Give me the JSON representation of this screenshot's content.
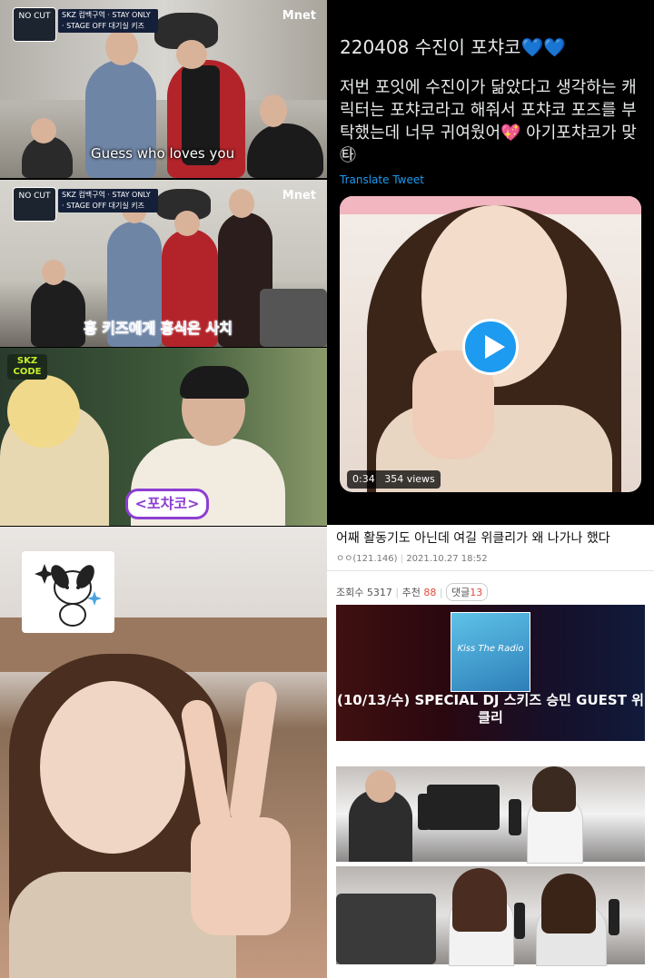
{
  "panel1": {
    "show_logo": "NO CUT",
    "strip_text": "SKZ 컴백구역 · STAY ONLY · STAGE OFF 대기실 키즈",
    "broadcaster": "Mnet",
    "caption": "Guess who loves you"
  },
  "panel2": {
    "show_logo": "NO CUT",
    "strip_text": "SKZ 컴백구역 · STAY ONLY · STAGE OFF 대기실 키즈",
    "broadcaster": "Mnet",
    "caption": "흥 키즈에게 흥식은 사치"
  },
  "panel3": {
    "show_logo": "SKZ CODE",
    "caption": "<포챠코>"
  },
  "tweet": {
    "title": "220408 수진이 포챠코💙💙",
    "body": "저번 포잇에 수진이가 닮았다고 생각하는 캐릭터는 포챠코라고 해줘서 포챠코 포즈를 부탁했는데 너무 귀여웠어💖 아기포챠코가 맞㉹",
    "translate_label": "Translate Tweet",
    "video_duration": "0:34",
    "video_views": "354 views"
  },
  "post": {
    "title": "어째 활동기도 아닌데 여길 위클리가 왜 나가나 했다",
    "author": "ㅇㅇ(121.146)",
    "date": "2021.10.27 18:52",
    "views_label": "조회수",
    "views": "5317",
    "recommend_label": "추천",
    "recommend": "88",
    "comments_label": "댓글",
    "comments": "13",
    "banner_caption": "(10/13/수) SPECIAL DJ 스키즈 승민 GUEST 위클리",
    "album_text": "Kiss The Radio"
  },
  "colors": {
    "twitter_blue": "#1d9bf0",
    "pochako_purple": "#8c3fd2",
    "caption_blue": "#2a67c9",
    "recommend_red": "#e34b3c"
  }
}
